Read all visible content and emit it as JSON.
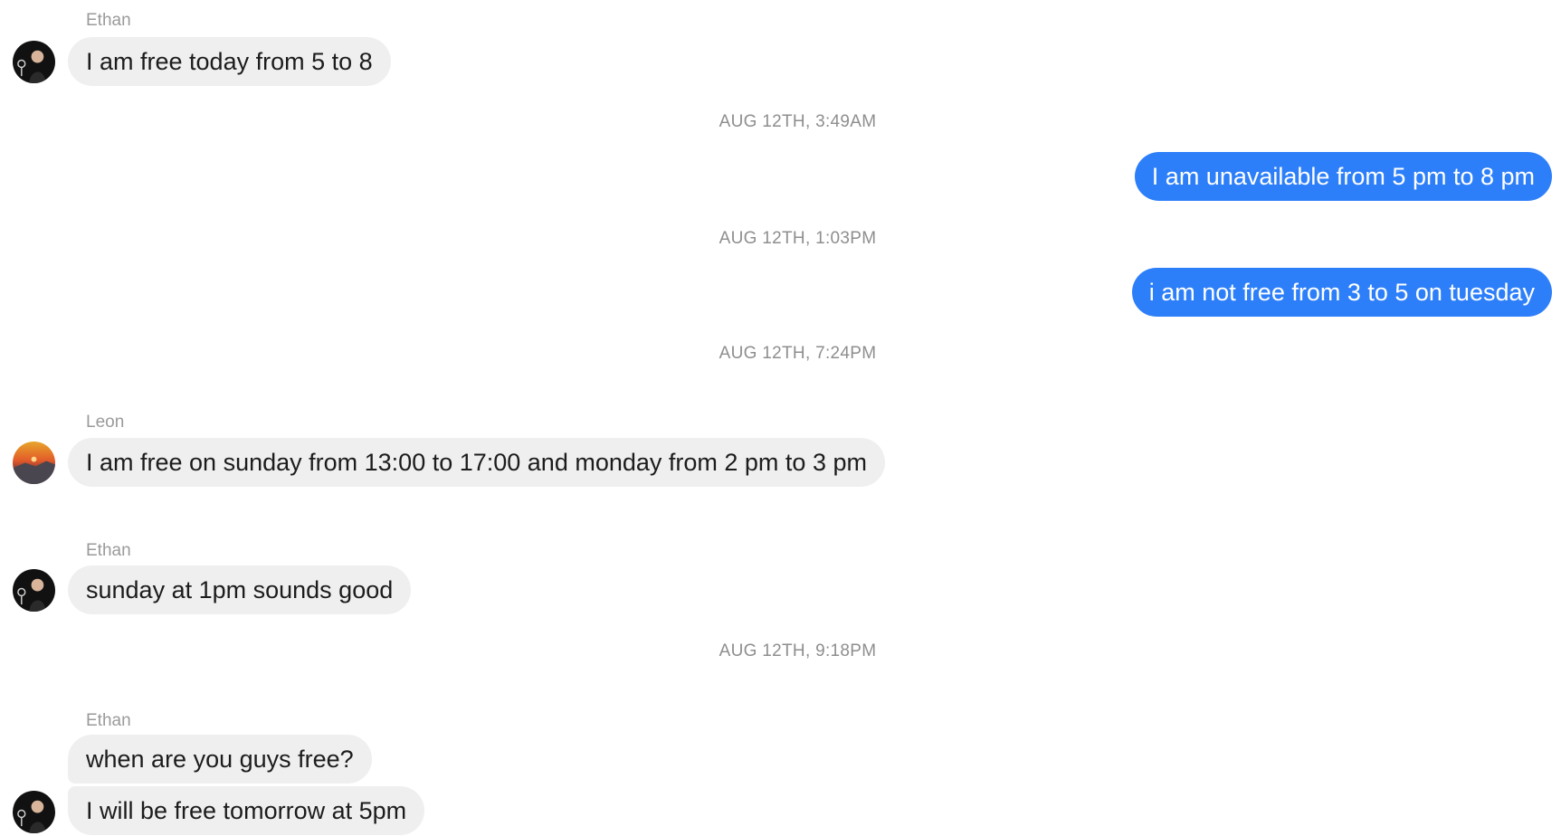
{
  "messages": [
    {
      "sender": "Ethan",
      "text": "I am free today from 5 to 8"
    },
    {
      "timestamp": "AUG 12TH, 3:49AM"
    },
    {
      "text": "I am unavailable from 5 pm to 8 pm"
    },
    {
      "timestamp": "AUG 12TH, 1:03PM"
    },
    {
      "text": "i am not free from 3 to 5 on tuesday"
    },
    {
      "timestamp": "AUG 12TH, 7:24PM"
    },
    {
      "sender": "Leon",
      "text": "I am free on sunday from 13:00 to 17:00 and monday from 2 pm to 3 pm"
    },
    {
      "sender": "Ethan",
      "text": "sunday at 1pm sounds good"
    },
    {
      "timestamp": "AUG 12TH, 9:18PM"
    },
    {
      "sender": "Ethan",
      "text": "when are you guys free?"
    },
    {
      "text": "I will be free tomorrow at 5pm"
    }
  ],
  "colors": {
    "outgoing_bubble": "#2d7ff9",
    "incoming_bubble": "#efefef"
  }
}
